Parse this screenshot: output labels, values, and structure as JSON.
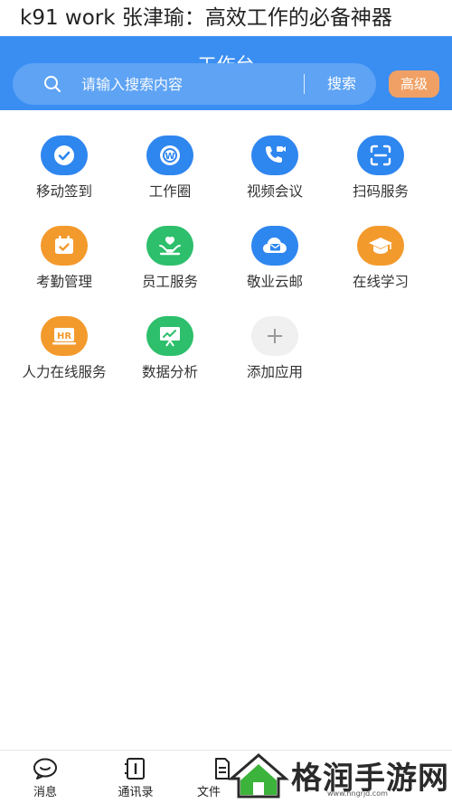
{
  "caption": "k91 work 张津瑜：高效工作的必备神器",
  "header": {
    "title": "工作台",
    "search_placeholder": "请输入搜索内容",
    "search_label": "搜索",
    "advanced_label": "高级",
    "bg_color": "#3a8ef2"
  },
  "apps": [
    {
      "label": "移动签到",
      "icon": "check-shield-icon",
      "color": "#2e86ef"
    },
    {
      "label": "工作圈",
      "icon": "work-circle-icon",
      "color": "#2e86ef"
    },
    {
      "label": "视频会议",
      "icon": "video-call-icon",
      "color": "#2e86ef"
    },
    {
      "label": "扫码服务",
      "icon": "scan-icon",
      "color": "#2e86ef"
    },
    {
      "label": "考勤管理",
      "icon": "calendar-icon",
      "color": "#f39a2c"
    },
    {
      "label": "员工服务",
      "icon": "employee-service-icon",
      "color": "#2dbf6c"
    },
    {
      "label": "敬业云邮",
      "icon": "cloud-mail-icon",
      "color": "#2e86ef"
    },
    {
      "label": "在线学习",
      "icon": "graduation-cap-icon",
      "color": "#f39a2c"
    },
    {
      "label": "人力在线服务",
      "icon": "hr-icon",
      "color": "#f39a2c"
    },
    {
      "label": "数据分析",
      "icon": "chart-board-icon",
      "color": "#2dbf6c"
    },
    {
      "label": "添加应用",
      "icon": "plus-icon",
      "color": "#f0f0f0"
    }
  ],
  "bottom_nav": [
    {
      "label": "消息",
      "icon": "message-icon"
    },
    {
      "label": "通讯录",
      "icon": "contacts-icon"
    },
    {
      "label": "文件",
      "icon": "file-icon"
    }
  ],
  "watermark": {
    "text": "格润手游网",
    "url": "www.hngrjd.com"
  }
}
